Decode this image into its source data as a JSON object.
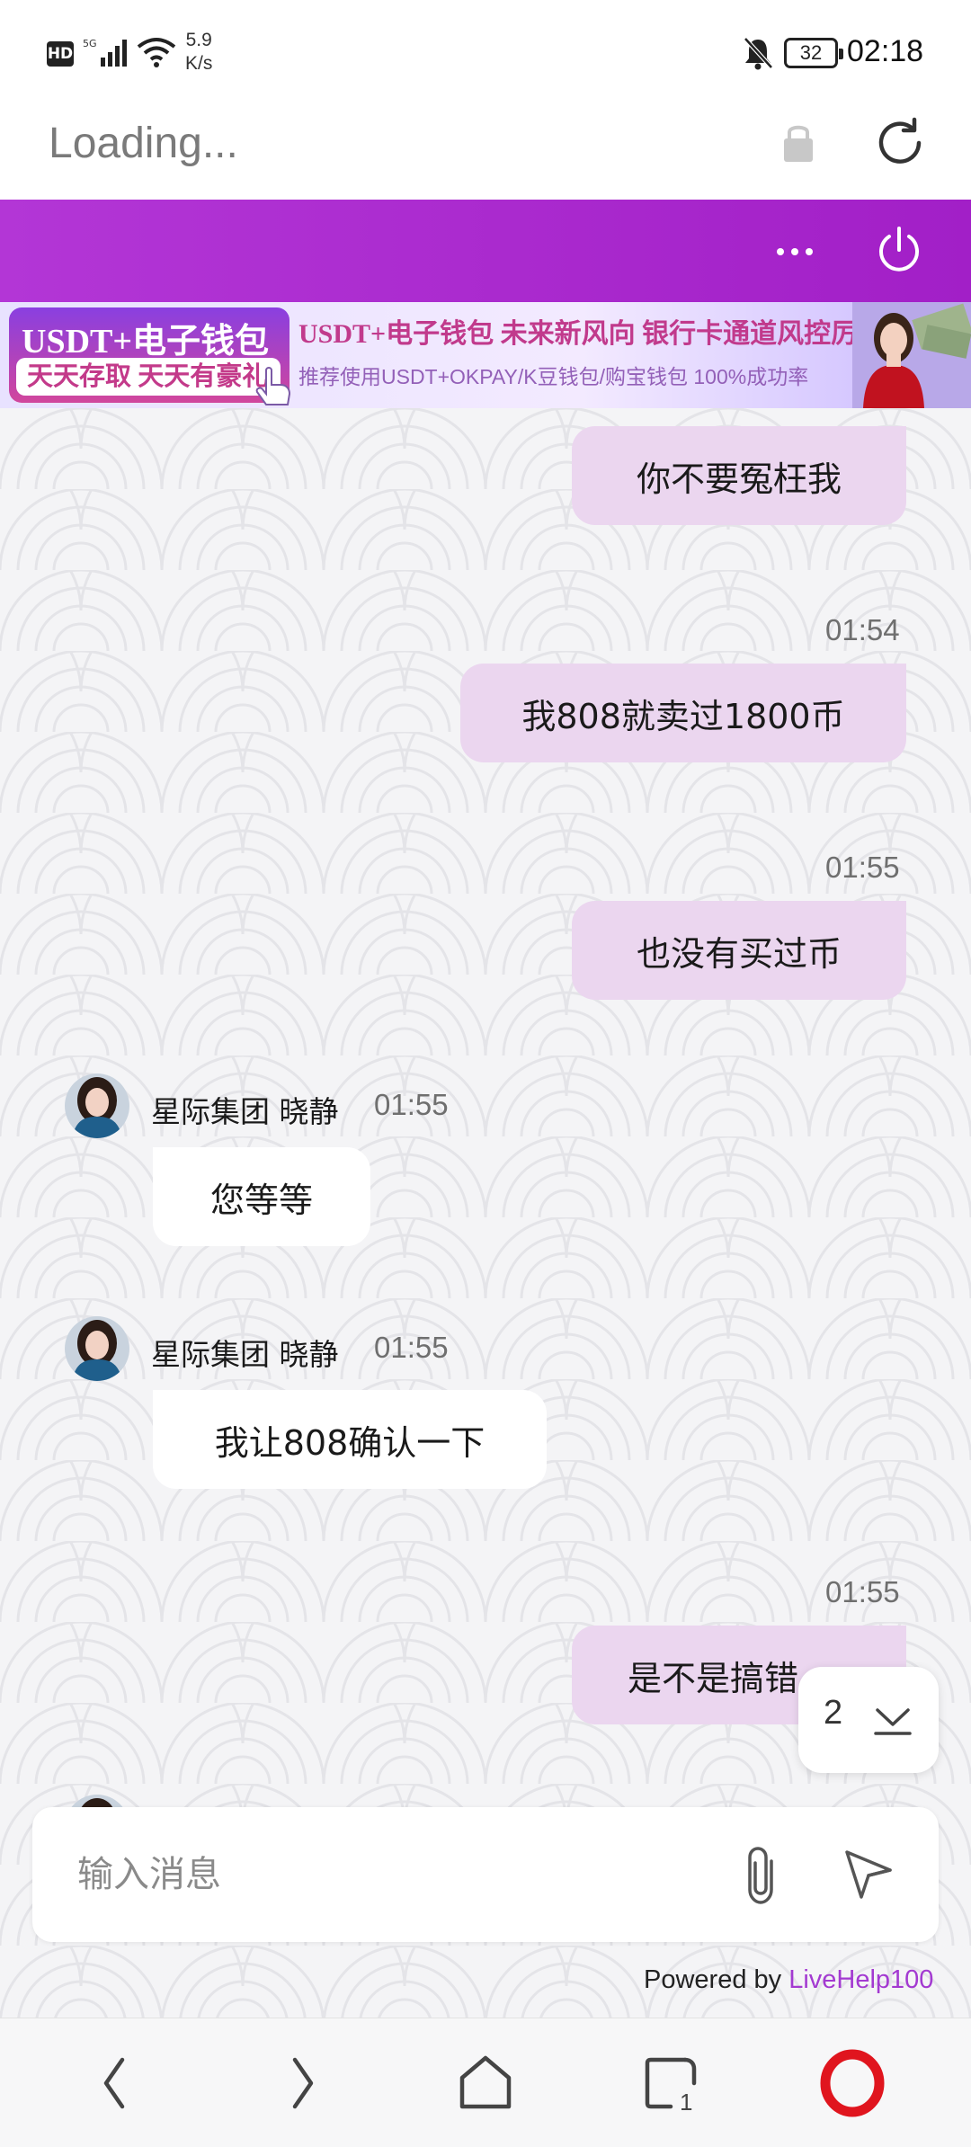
{
  "status_bar": {
    "hd": "HD",
    "network": "5G",
    "speed_value": "5.9",
    "speed_unit": "K/s",
    "battery": "32",
    "time": "02:18"
  },
  "address_bar": {
    "text": "Loading..."
  },
  "colors": {
    "header_accent": "#a21fc7",
    "outgoing_bubble": "#ebd6ef",
    "incoming_bubble": "#ffffff",
    "brand_link": "#a33ad1"
  },
  "banner": {
    "left_top": "USDT+电子钱包",
    "left_bottom": "天天存取 天天有豪礼",
    "line1": "USDT+电子钱包  未来新风向  银行卡通道风控厉害",
    "line2": "推荐使用USDT+OKPAY/K豆钱包/购宝钱包  100%成功率"
  },
  "messages": [
    {
      "direction": "out",
      "text": "你不要冤枉我"
    },
    {
      "direction": "out",
      "time": "01:54",
      "text": "我808就卖过1800币"
    },
    {
      "direction": "out",
      "time": "01:55",
      "text": "也没有买过币"
    },
    {
      "direction": "in",
      "sender": "星际集团 晓静",
      "time": "01:55",
      "text": "您等等"
    },
    {
      "direction": "in",
      "sender": "星际集团 晓静",
      "time": "01:55",
      "text": "我让808确认一下"
    },
    {
      "direction": "out",
      "time": "01:55",
      "text": "是不是搞错"
    }
  ],
  "scroll_badge": {
    "count": "2"
  },
  "composer": {
    "placeholder": "输入消息"
  },
  "footer": {
    "powered_prefix": "Powered by ",
    "powered_brand": "LiveHelp100"
  },
  "bottom_nav": {
    "tabs_count": "1"
  }
}
